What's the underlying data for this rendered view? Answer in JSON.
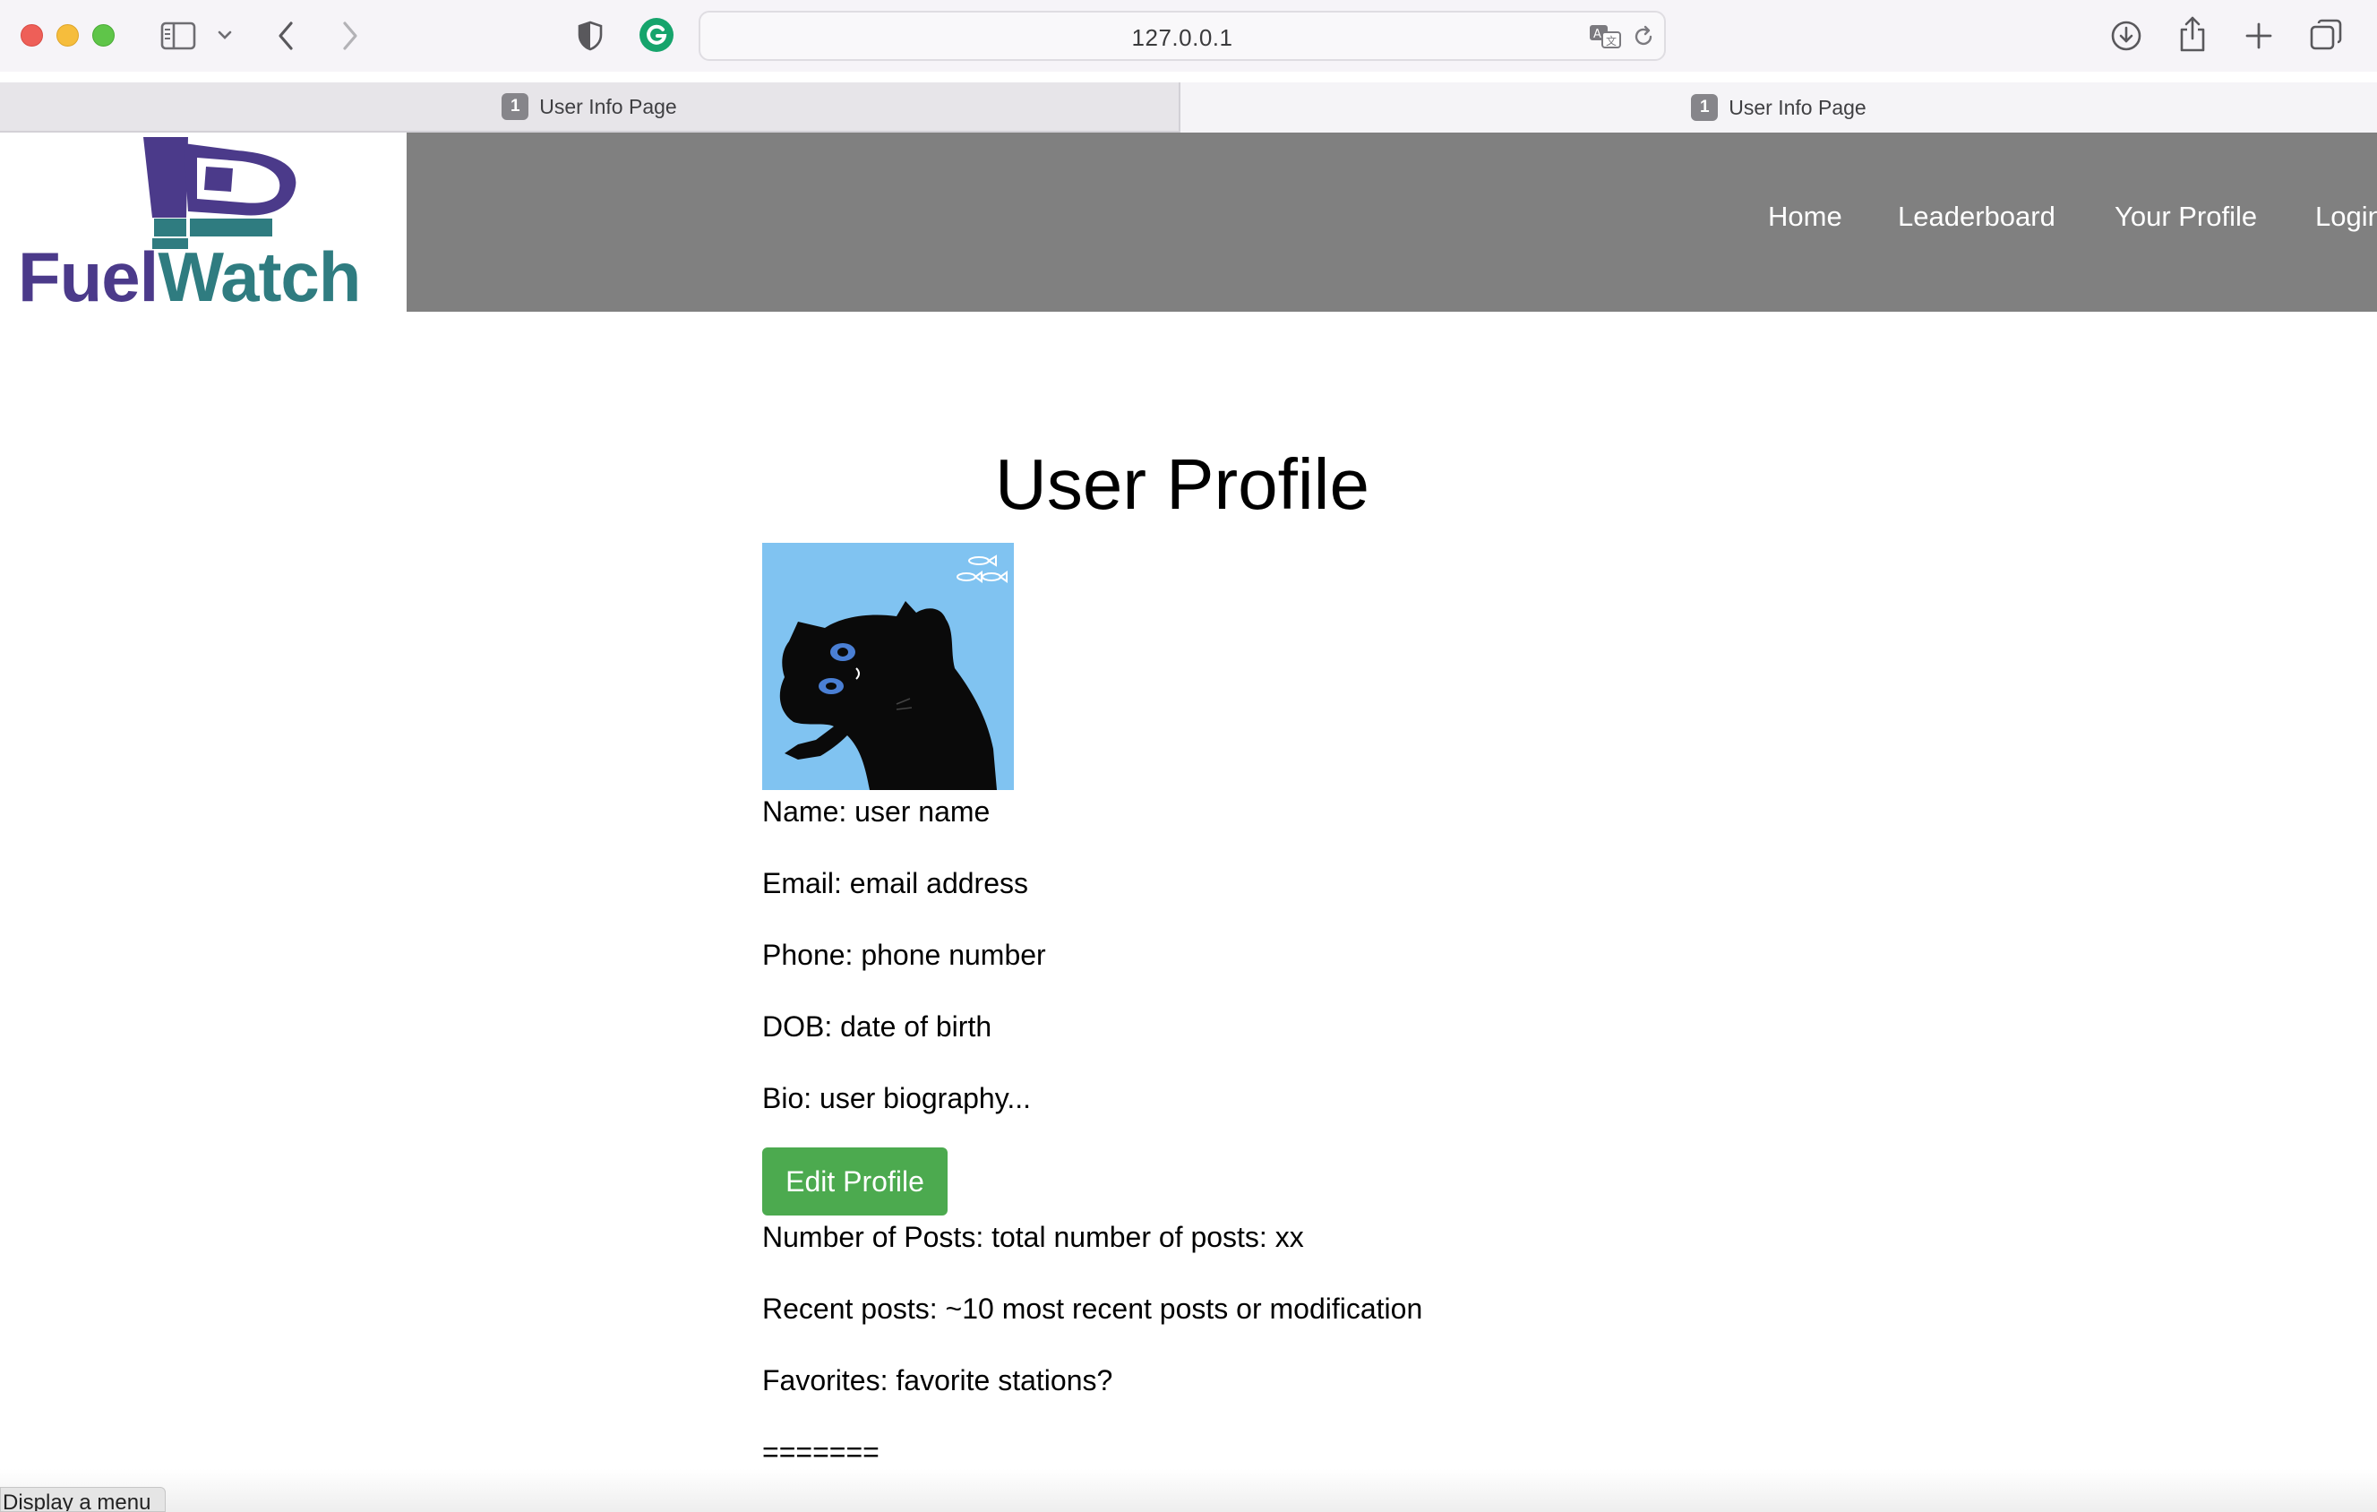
{
  "browser": {
    "url": "127.0.0.1",
    "tabs": [
      {
        "count": "1",
        "title": "User Info Page"
      },
      {
        "count": "1",
        "title": "User Info Page"
      }
    ],
    "status_tooltip": "Display a menu"
  },
  "site": {
    "logo": {
      "part1": "Fuel",
      "part2": "Watch"
    },
    "nav": [
      "Home",
      "Leaderboard",
      "Your Profile",
      "Login"
    ]
  },
  "profile": {
    "title": "User Profile",
    "name": "Name: user name",
    "email": "Email: email address",
    "phone": "Phone: phone number",
    "dob": "DOB: date of birth",
    "bio": "Bio: user biography...",
    "edit_button": "Edit Profile",
    "num_posts": "Number of Posts: total number of posts: xx",
    "recent_posts": "Recent posts: ~10 most recent posts or modification",
    "favorites": "Favorites: favorite stations?",
    "separator": "======="
  },
  "colors": {
    "header_bg": "#808080",
    "logo_purple": "#4b3a8a",
    "logo_teal": "#2f7c80",
    "button_green": "#4caa4f",
    "avatar_bg": "#80c3f1"
  }
}
